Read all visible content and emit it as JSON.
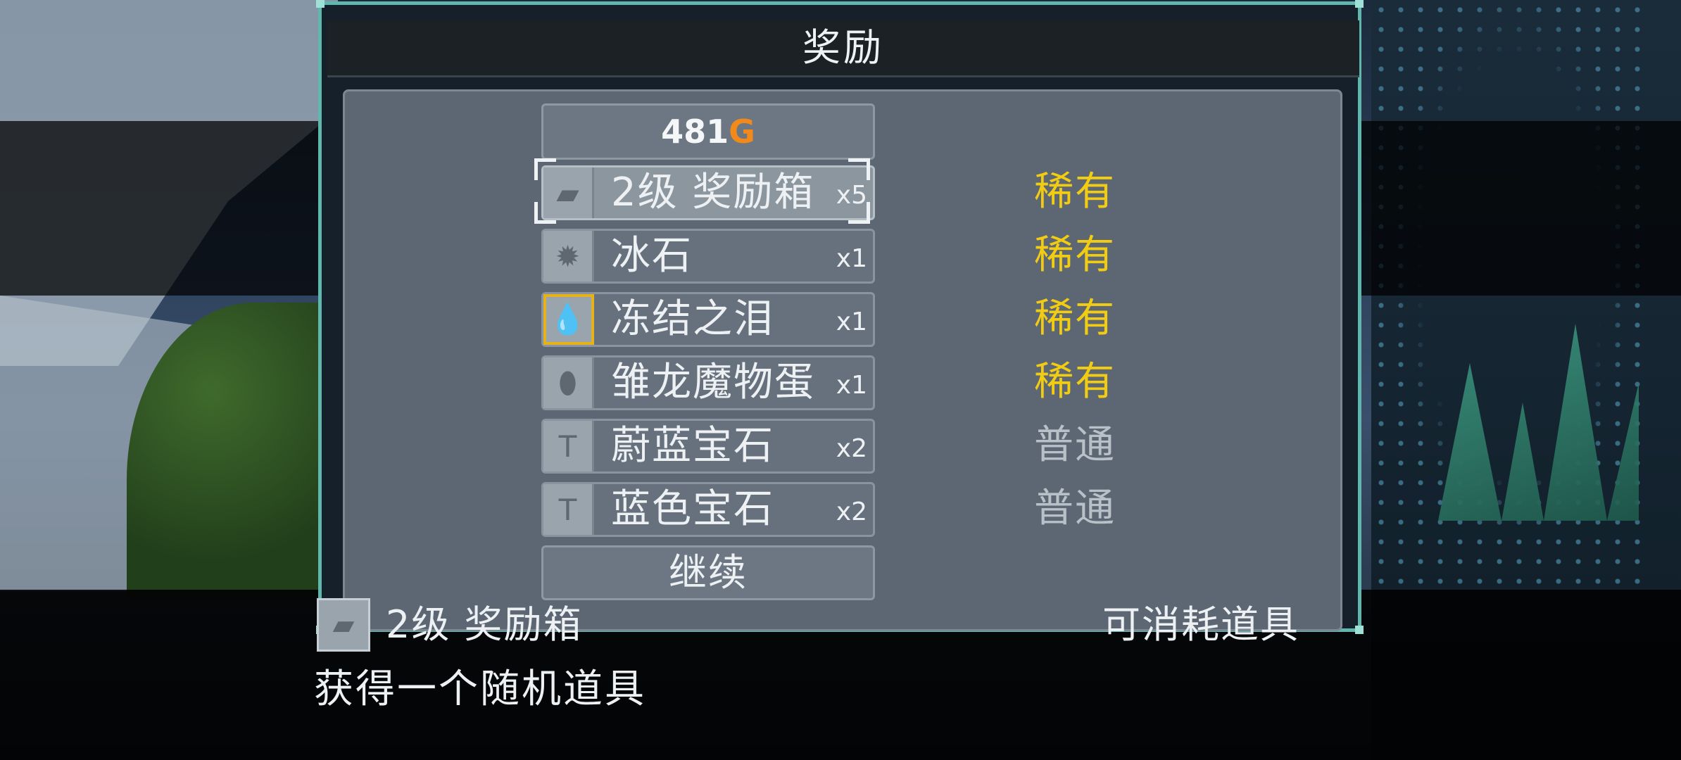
{
  "window": {
    "title": "奖励"
  },
  "gold": {
    "amount": "481",
    "unit": "G"
  },
  "rewards": [
    {
      "name": "2级 奖励箱",
      "qty": "x5",
      "rarity": "稀有",
      "icon": "chest-icon",
      "glyph": "▰"
    },
    {
      "name": "冰石",
      "qty": "x1",
      "rarity": "稀有",
      "icon": "ice-stone-icon",
      "glyph": "✹"
    },
    {
      "name": "冻结之泪",
      "qty": "x1",
      "rarity": "稀有",
      "icon": "tear-drop-icon",
      "glyph": "💧"
    },
    {
      "name": "雏龙魔物蛋",
      "qty": "x1",
      "rarity": "稀有",
      "icon": "egg-icon",
      "glyph": "⬮"
    },
    {
      "name": "蔚蓝宝石",
      "qty": "x2",
      "rarity": "普通",
      "icon": "hammer-icon",
      "glyph": "T"
    },
    {
      "name": "蓝色宝石",
      "qty": "x2",
      "rarity": "普通",
      "icon": "hammer-icon",
      "glyph": "T"
    }
  ],
  "colors": {
    "rare": "#f2cc12",
    "common": "#b8c0c8",
    "gold": "#f28a1b",
    "border": "#5fb7ad"
  },
  "continue_label": "继续",
  "info": {
    "name": "2级 奖励箱",
    "type": "可消耗道具",
    "description": "获得一个随机道具"
  }
}
